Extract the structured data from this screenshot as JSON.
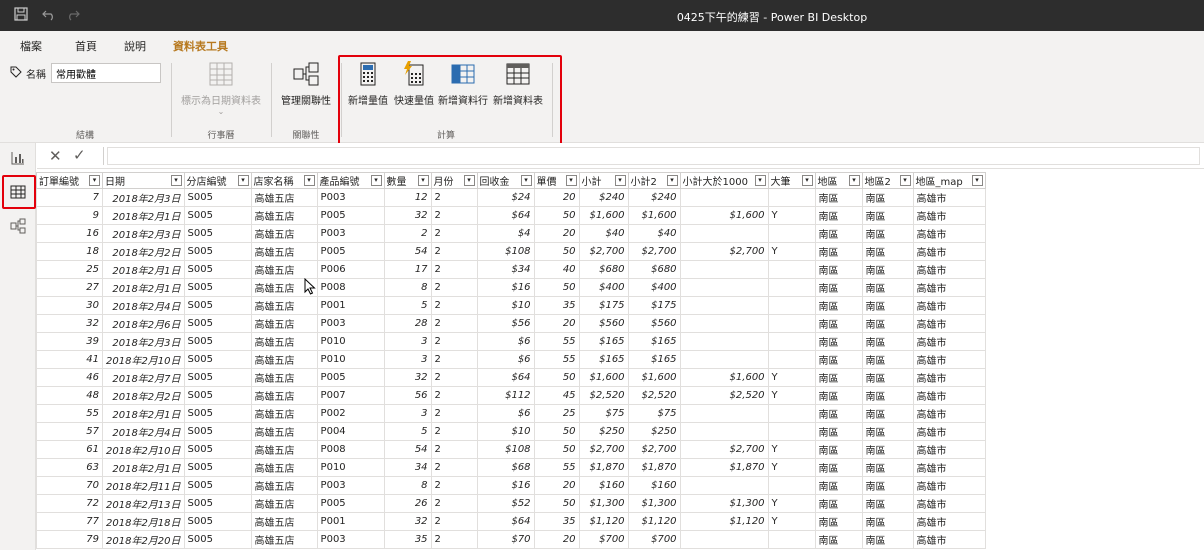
{
  "window": {
    "title": "0425下午的練習 - Power BI Desktop"
  },
  "quick_access": {
    "save_icon": "save-icon",
    "undo_icon": "undo-icon",
    "redo_icon": "redo-icon"
  },
  "tabs": [
    {
      "label": "檔案"
    },
    {
      "label": "首頁"
    },
    {
      "label": "說明"
    },
    {
      "label": "資料表工具"
    }
  ],
  "ribbon": {
    "name_label": "名稱",
    "name_value": "常用歡體",
    "group_structure": "結構",
    "mark_date_table": "標示為日期資料表",
    "group_calendar": "行事曆",
    "manage_relationships": "管理關聯性",
    "group_relationships": "關聯性",
    "new_measure": "新增量值",
    "quick_measure": "快速量值",
    "new_column": "新增資料行",
    "new_table": "新增資料表",
    "group_calculations": "計算"
  },
  "columns": [
    "訂單編號",
    "日期",
    "分店編號",
    "店家名稱",
    "產品編號",
    "數量",
    "月份",
    "回收金",
    "單價",
    "小計",
    "小計2",
    "小計大於1000",
    "大筆",
    "地區",
    "地區2",
    "地區_map"
  ],
  "rows": [
    [
      "7",
      "2018年2月3日",
      "S005",
      "高雄五店",
      "P003",
      "12",
      "2",
      "$24",
      "20",
      "$240",
      "$240",
      "",
      "",
      "南區",
      "南區",
      "高雄市"
    ],
    [
      "9",
      "2018年2月1日",
      "S005",
      "高雄五店",
      "P005",
      "32",
      "2",
      "$64",
      "50",
      "$1,600",
      "$1,600",
      "$1,600",
      "Y",
      "南區",
      "南區",
      "高雄市"
    ],
    [
      "16",
      "2018年2月3日",
      "S005",
      "高雄五店",
      "P003",
      "2",
      "2",
      "$4",
      "20",
      "$40",
      "$40",
      "",
      "",
      "南區",
      "南區",
      "高雄市"
    ],
    [
      "18",
      "2018年2月2日",
      "S005",
      "高雄五店",
      "P005",
      "54",
      "2",
      "$108",
      "50",
      "$2,700",
      "$2,700",
      "$2,700",
      "Y",
      "南區",
      "南區",
      "高雄市"
    ],
    [
      "25",
      "2018年2月1日",
      "S005",
      "高雄五店",
      "P006",
      "17",
      "2",
      "$34",
      "40",
      "$680",
      "$680",
      "",
      "",
      "南區",
      "南區",
      "高雄市"
    ],
    [
      "27",
      "2018年2月1日",
      "S005",
      "高雄五店",
      "P008",
      "8",
      "2",
      "$16",
      "50",
      "$400",
      "$400",
      "",
      "",
      "南區",
      "南區",
      "高雄市"
    ],
    [
      "30",
      "2018年2月4日",
      "S005",
      "高雄五店",
      "P001",
      "5",
      "2",
      "$10",
      "35",
      "$175",
      "$175",
      "",
      "",
      "南區",
      "南區",
      "高雄市"
    ],
    [
      "32",
      "2018年2月6日",
      "S005",
      "高雄五店",
      "P003",
      "28",
      "2",
      "$56",
      "20",
      "$560",
      "$560",
      "",
      "",
      "南區",
      "南區",
      "高雄市"
    ],
    [
      "39",
      "2018年2月3日",
      "S005",
      "高雄五店",
      "P010",
      "3",
      "2",
      "$6",
      "55",
      "$165",
      "$165",
      "",
      "",
      "南區",
      "南區",
      "高雄市"
    ],
    [
      "41",
      "2018年2月10日",
      "S005",
      "高雄五店",
      "P010",
      "3",
      "2",
      "$6",
      "55",
      "$165",
      "$165",
      "",
      "",
      "南區",
      "南區",
      "高雄市"
    ],
    [
      "46",
      "2018年2月7日",
      "S005",
      "高雄五店",
      "P005",
      "32",
      "2",
      "$64",
      "50",
      "$1,600",
      "$1,600",
      "$1,600",
      "Y",
      "南區",
      "南區",
      "高雄市"
    ],
    [
      "48",
      "2018年2月2日",
      "S005",
      "高雄五店",
      "P007",
      "56",
      "2",
      "$112",
      "45",
      "$2,520",
      "$2,520",
      "$2,520",
      "Y",
      "南區",
      "南區",
      "高雄市"
    ],
    [
      "55",
      "2018年2月1日",
      "S005",
      "高雄五店",
      "P002",
      "3",
      "2",
      "$6",
      "25",
      "$75",
      "$75",
      "",
      "",
      "南區",
      "南區",
      "高雄市"
    ],
    [
      "57",
      "2018年2月4日",
      "S005",
      "高雄五店",
      "P004",
      "5",
      "2",
      "$10",
      "50",
      "$250",
      "$250",
      "",
      "",
      "南區",
      "南區",
      "高雄市"
    ],
    [
      "61",
      "2018年2月10日",
      "S005",
      "高雄五店",
      "P008",
      "54",
      "2",
      "$108",
      "50",
      "$2,700",
      "$2,700",
      "$2,700",
      "Y",
      "南區",
      "南區",
      "高雄市"
    ],
    [
      "63",
      "2018年2月1日",
      "S005",
      "高雄五店",
      "P010",
      "34",
      "2",
      "$68",
      "55",
      "$1,870",
      "$1,870",
      "$1,870",
      "Y",
      "南區",
      "南區",
      "高雄市"
    ],
    [
      "70",
      "2018年2月11日",
      "S005",
      "高雄五店",
      "P003",
      "8",
      "2",
      "$16",
      "20",
      "$160",
      "$160",
      "",
      "",
      "南區",
      "南區",
      "高雄市"
    ],
    [
      "72",
      "2018年2月13日",
      "S005",
      "高雄五店",
      "P005",
      "26",
      "2",
      "$52",
      "50",
      "$1,300",
      "$1,300",
      "$1,300",
      "Y",
      "南區",
      "南區",
      "高雄市"
    ],
    [
      "77",
      "2018年2月18日",
      "S005",
      "高雄五店",
      "P001",
      "32",
      "2",
      "$64",
      "35",
      "$1,120",
      "$1,120",
      "$1,120",
      "Y",
      "南區",
      "南區",
      "高雄市"
    ],
    [
      "79",
      "2018年2月20日",
      "S005",
      "高雄五店",
      "P003",
      "35",
      "2",
      "$70",
      "20",
      "$700",
      "$700",
      "",
      "",
      "南區",
      "南區",
      "高雄市"
    ]
  ],
  "colors": {
    "accent": "#d4a017",
    "highlight": "#e3000b",
    "titlebar": "#2d2d2d"
  }
}
